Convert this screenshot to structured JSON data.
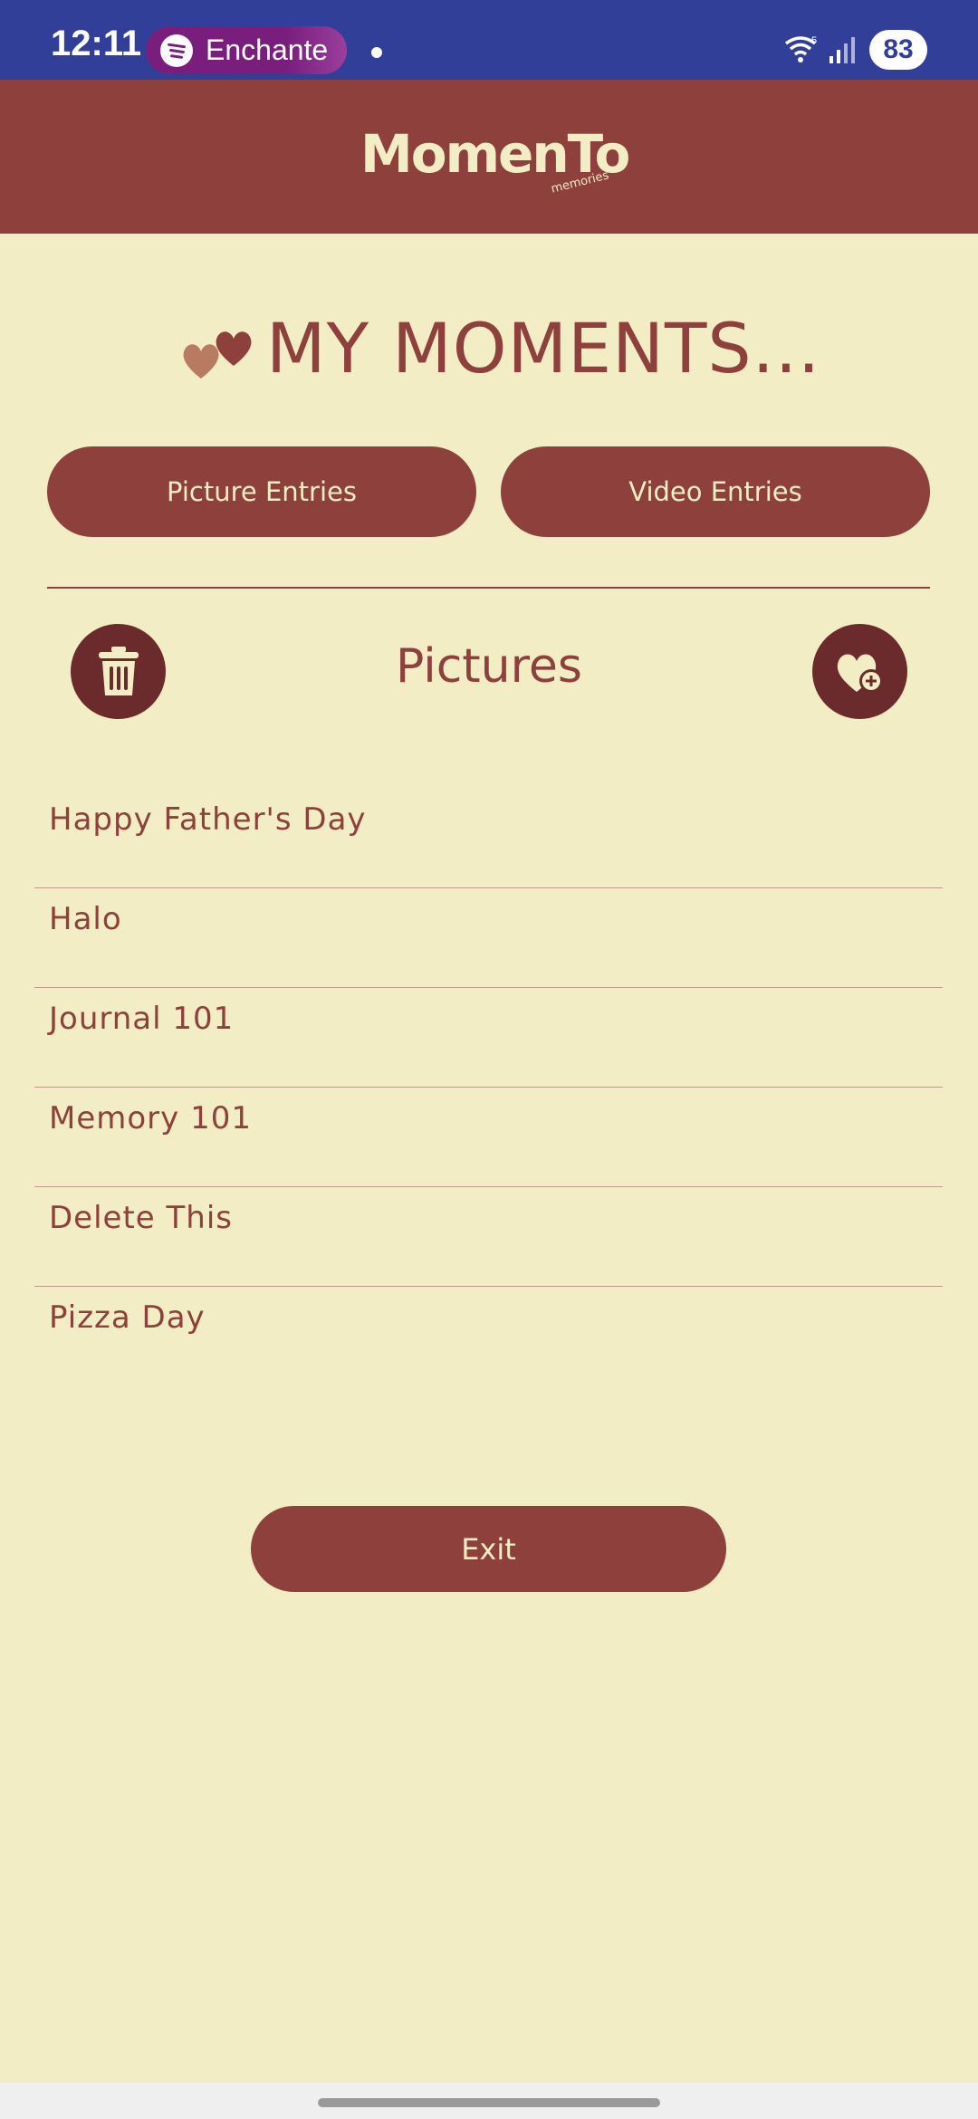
{
  "status_bar": {
    "time": "12:11",
    "media_app": "Enchante",
    "battery": "83"
  },
  "header": {
    "logo_text": "MomenTo",
    "logo_subtext": "memories"
  },
  "page": {
    "title": "MY MOMENTS..."
  },
  "tabs": [
    {
      "label": "Picture Entries"
    },
    {
      "label": "Video Entries"
    }
  ],
  "section": {
    "title": "Pictures"
  },
  "entries": [
    {
      "label": "Happy Father's Day"
    },
    {
      "label": "Halo"
    },
    {
      "label": "Journal 101"
    },
    {
      "label": "Memory 101"
    },
    {
      "label": "Delete This"
    },
    {
      "label": "Pizza Day"
    }
  ],
  "actions": {
    "exit_label": "Exit",
    "delete_icon": "trash-icon",
    "add_icon": "heart-plus-icon"
  },
  "colors": {
    "status_bar": "#323F99",
    "primary": "#8D403C",
    "dark_accent": "#6B2A2B",
    "background": "#F3EDC6"
  }
}
